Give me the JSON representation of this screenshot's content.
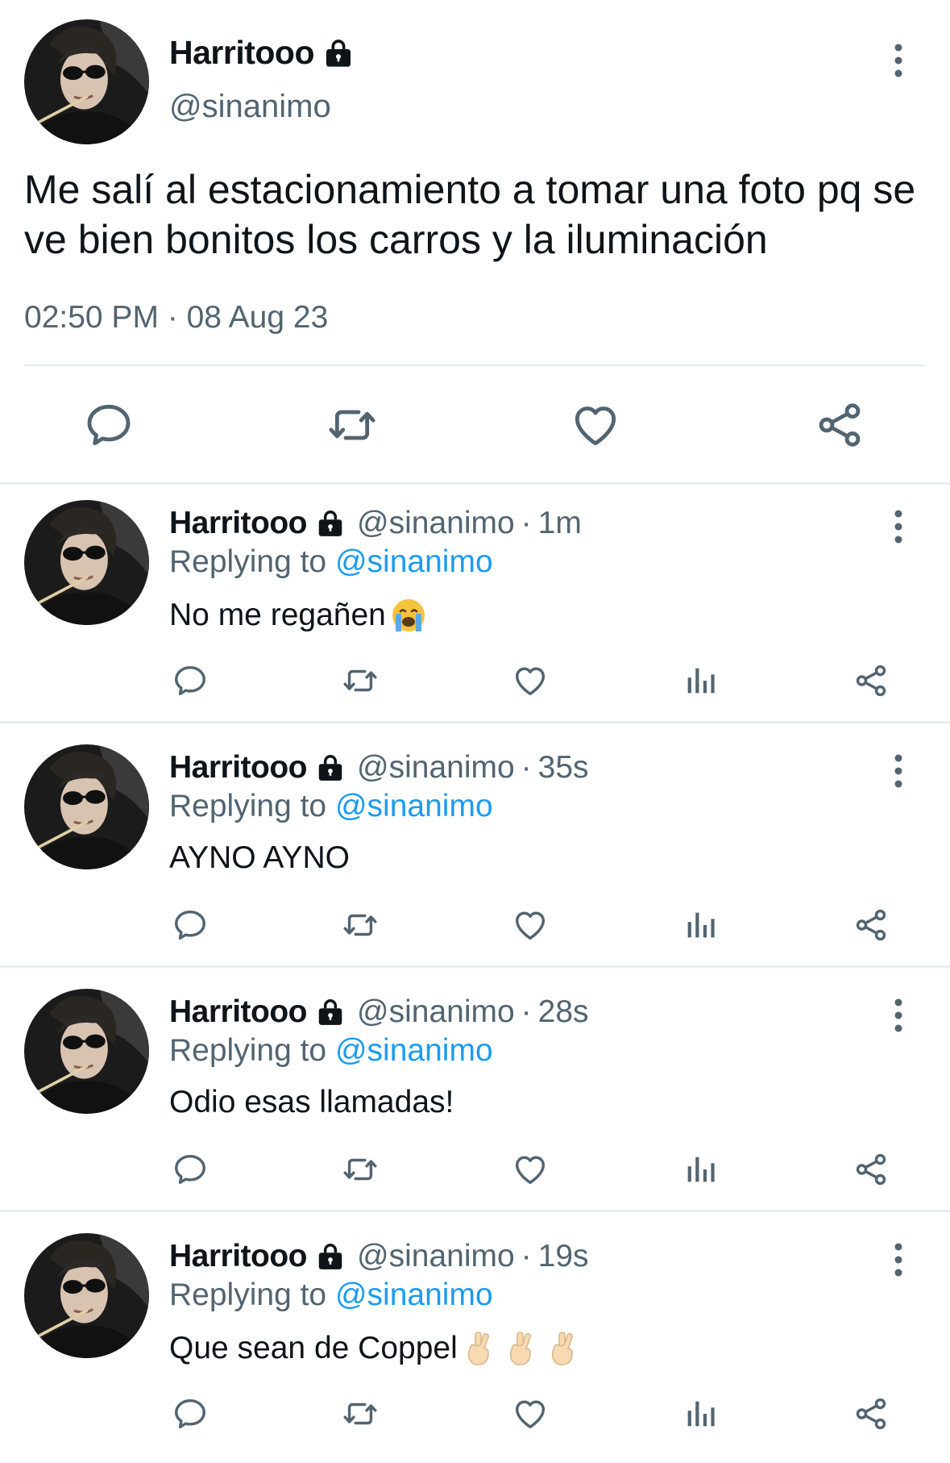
{
  "main_tweet": {
    "display_name": "Harritooo",
    "handle": "@sinanimo",
    "text": "Me salí al estacionamiento a tomar una foto pq se ve bien bonitos los carros y la iluminación",
    "timestamp": "02:50 PM · 08 Aug 23",
    "icons": {
      "protected": "lock-icon",
      "menu": "more-vertical-icon",
      "reply": "reply-icon",
      "retweet": "retweet-icon",
      "like": "heart-icon",
      "share": "share-icon"
    }
  },
  "replies": [
    {
      "display_name": "Harritooo",
      "handle": "@sinanimo",
      "separator": "·",
      "time": "1m",
      "replying_prefix": "Replying to",
      "replying_to": "@sinanimo",
      "text": "No me regañen",
      "emoji": [
        "loudly-crying-face"
      ]
    },
    {
      "display_name": "Harritooo",
      "handle": "@sinanimo",
      "separator": "·",
      "time": "35s",
      "replying_prefix": "Replying to",
      "replying_to": "@sinanimo",
      "text": "AYNO AYNO",
      "emoji": []
    },
    {
      "display_name": "Harritooo",
      "handle": "@sinanimo",
      "separator": "·",
      "time": "28s",
      "replying_prefix": "Replying to",
      "replying_to": "@sinanimo",
      "text": "Odio esas llamadas!",
      "emoji": []
    },
    {
      "display_name": "Harritooo",
      "handle": "@sinanimo",
      "separator": "·",
      "time": "19s",
      "replying_prefix": "Replying to",
      "replying_to": "@sinanimo",
      "text": "Que sean de Coppel",
      "emoji": [
        "crossed-fingers",
        "crossed-fingers",
        "crossed-fingers"
      ]
    }
  ],
  "colors": {
    "text": "#0f1419",
    "secondary": "#536471",
    "link": "#1d9bf0",
    "icon": "#536471",
    "divider": "#e6ecf0"
  }
}
